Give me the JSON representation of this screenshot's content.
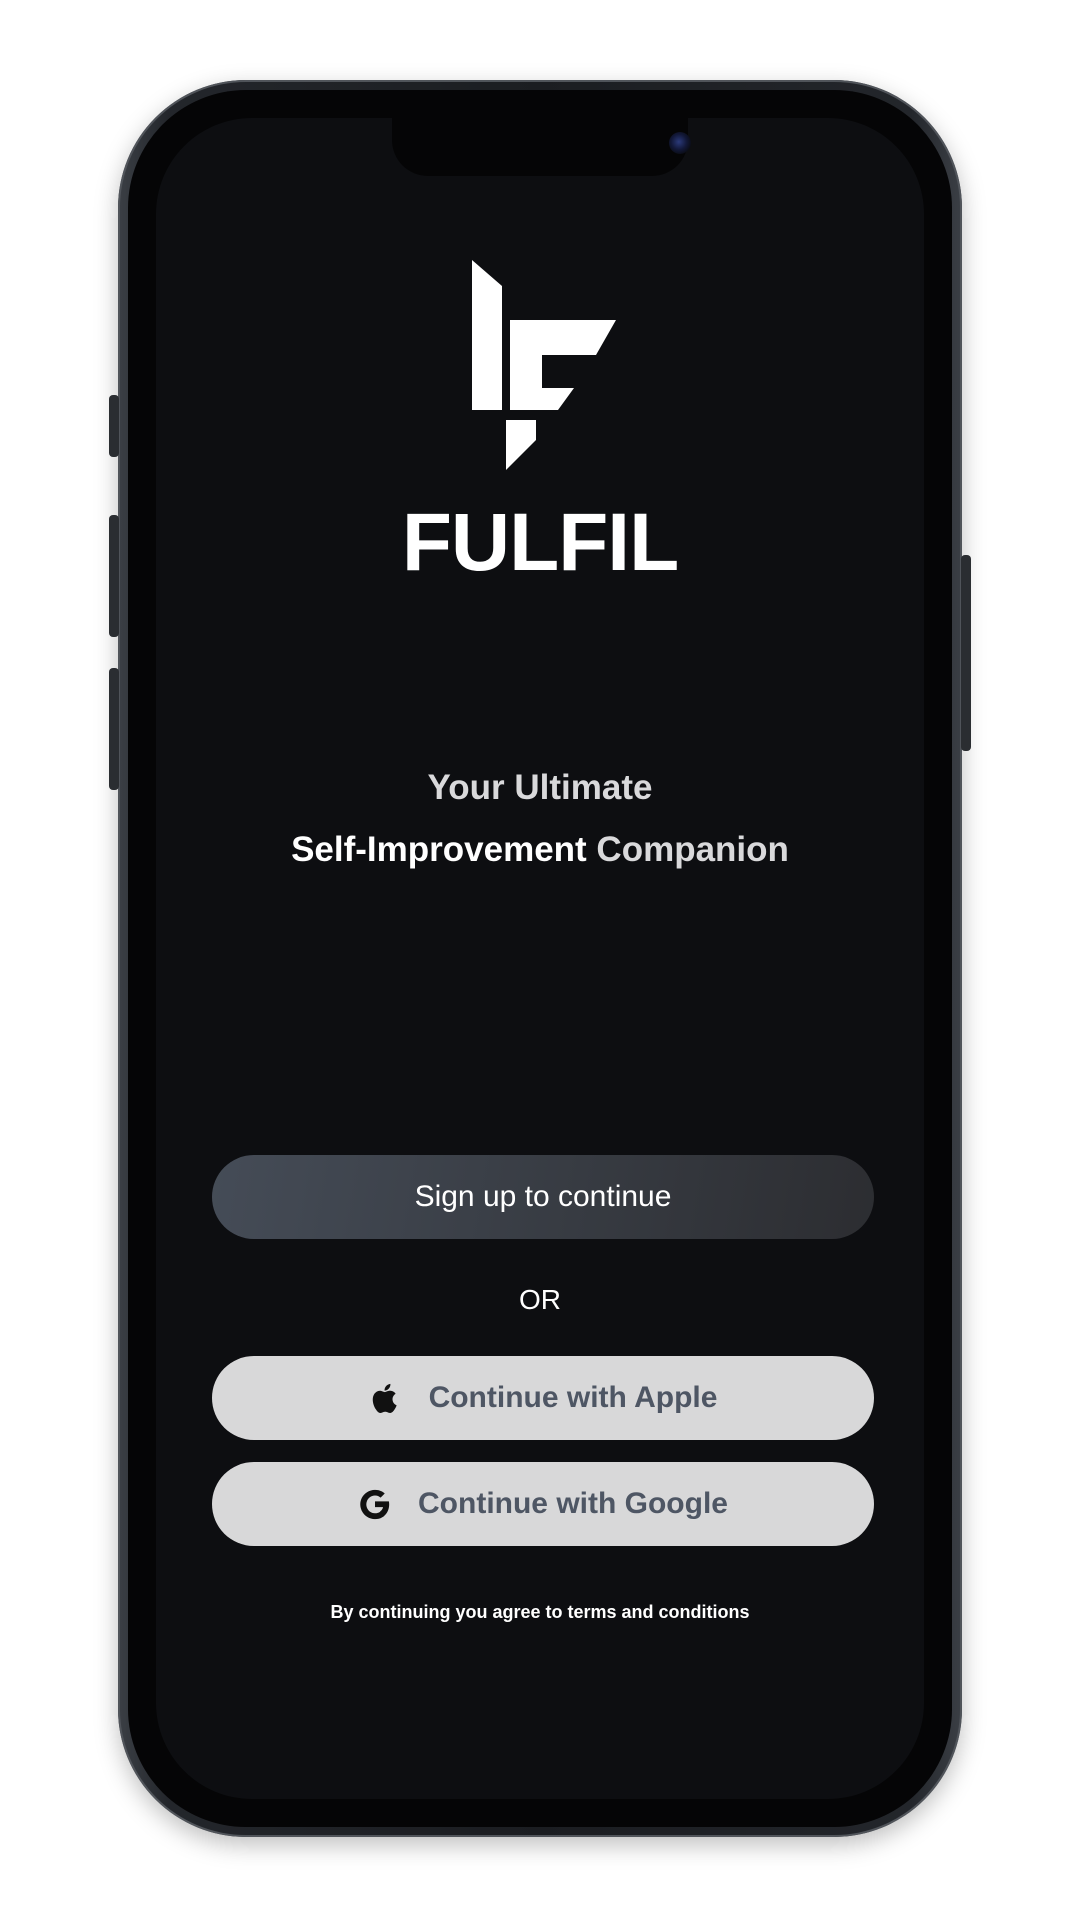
{
  "app": {
    "brand_name": "FULFIL",
    "logo_icon": "fulfil-logo-icon"
  },
  "tagline": {
    "line1": "Your Ultimate",
    "line2_strong": "Self-Improvement",
    "line2_rest": " Companion"
  },
  "auth": {
    "signup_label": "Sign up to continue",
    "or_label": "OR",
    "apple_label": "Continue with Apple",
    "apple_icon": "apple-icon",
    "google_label": "Continue with Google",
    "google_icon": "google-icon",
    "terms_text": "By  continuing you agree to terms and conditions"
  },
  "colors": {
    "screen_background": "#0d0e11",
    "primary_button_gradient_start": "#454c57",
    "primary_button_gradient_end": "#2c2d31",
    "secondary_button_background": "#d8d8d9",
    "secondary_button_text": "#4e5664",
    "text_primary": "#ffffff"
  }
}
